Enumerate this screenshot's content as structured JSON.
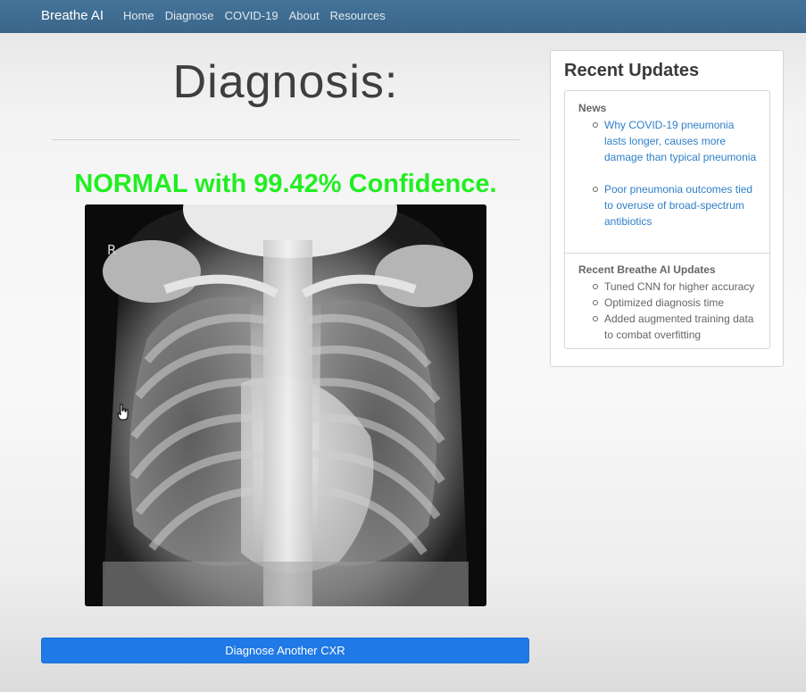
{
  "navbar": {
    "brand": "Breathe AI",
    "links": [
      "Home",
      "Diagnose",
      "COVID-19",
      "About",
      "Resources"
    ]
  },
  "main": {
    "title": "Diagnosis:",
    "result": "NORMAL with 99.42% Confidence.",
    "xray_marker": "R",
    "button_label": "Diagnose Another CXR"
  },
  "sidebar": {
    "title": "Recent Updates",
    "news": {
      "heading": "News",
      "items": [
        "Why COVID-19 pneumonia lasts longer, causes more damage than typical pneumonia",
        "Poor pneumonia outcomes tied to overuse of broad-spectrum antibiotics"
      ]
    },
    "updates": {
      "heading": "Recent Breathe AI Updates",
      "items": [
        "Tuned CNN for higher accuracy",
        "Optimized diagnosis time",
        "Added augmented training data to combat overfitting"
      ]
    }
  },
  "colors": {
    "navbar": "#3f6b8d",
    "result": "#22ee22",
    "button": "#1f79e6",
    "link": "#2d7fc8"
  },
  "icons": {
    "cursor": "hand-pointer-icon"
  }
}
